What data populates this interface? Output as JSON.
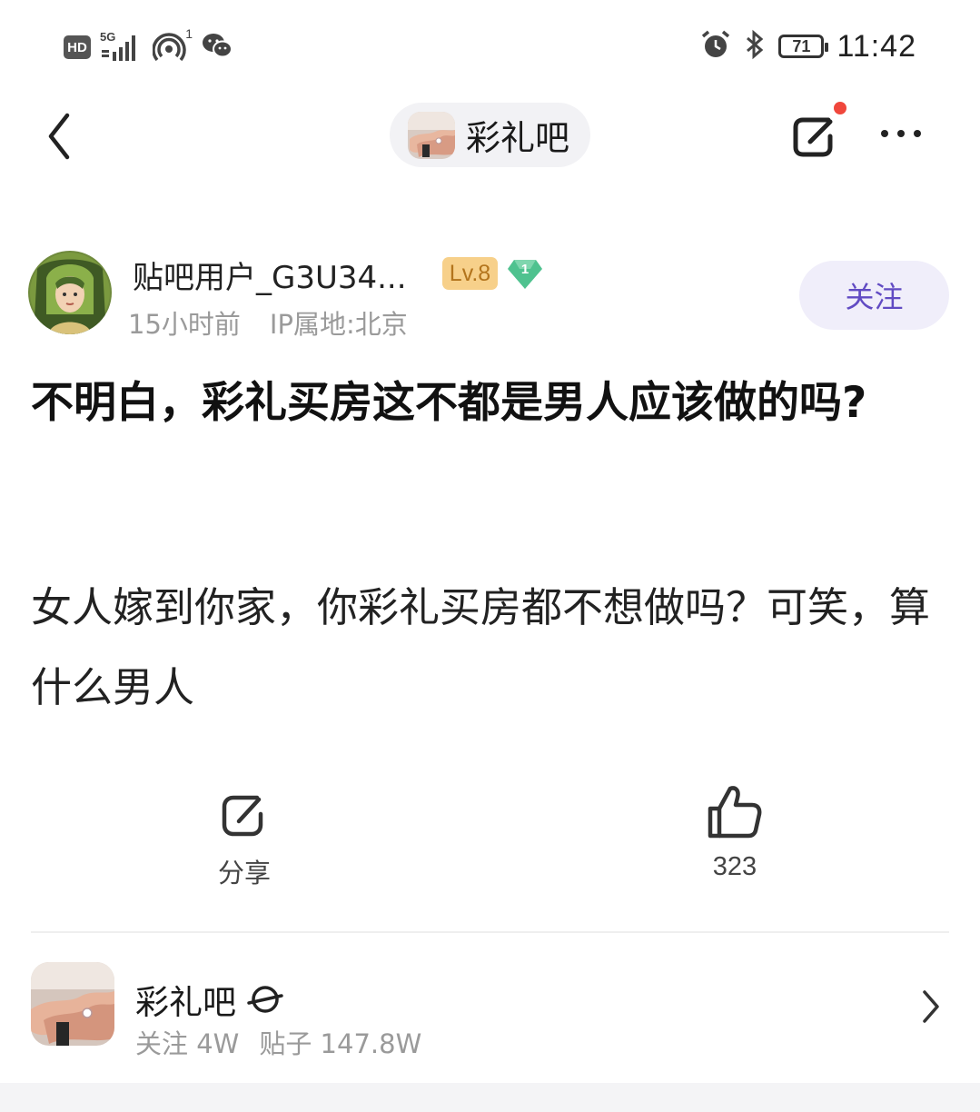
{
  "status_bar": {
    "hd_label": "HD",
    "network_label": "5G",
    "hotspot_count": "1",
    "battery": "71",
    "time": "11:42"
  },
  "nav": {
    "forum_name": "彩礼吧",
    "icons": [
      "back-chevron-icon",
      "share-icon",
      "more-icon"
    ]
  },
  "author": {
    "name": "贴吧用户_G3U34...",
    "level": "Lv.8",
    "badge_number": "1",
    "time_ago": "15小时前",
    "location": "IP属地:北京",
    "follow_label": "关注"
  },
  "post": {
    "title": "不明白，彩礼买房这不都是男人应该做的吗?",
    "body": "女人嫁到你家，你彩礼买房都不想做吗？可笑，算什么男人"
  },
  "actions": {
    "share_label": "分享",
    "like_count": "323"
  },
  "forum_card": {
    "name": "彩礼吧",
    "followers": "关注 4W",
    "posts": "贴子 147.8W"
  },
  "colors": {
    "accent": "#614bc3",
    "follow_bg": "#f0eefa",
    "notification": "#f0473c",
    "level_bg": "#f7d08a",
    "gem": "#4fc28f"
  }
}
